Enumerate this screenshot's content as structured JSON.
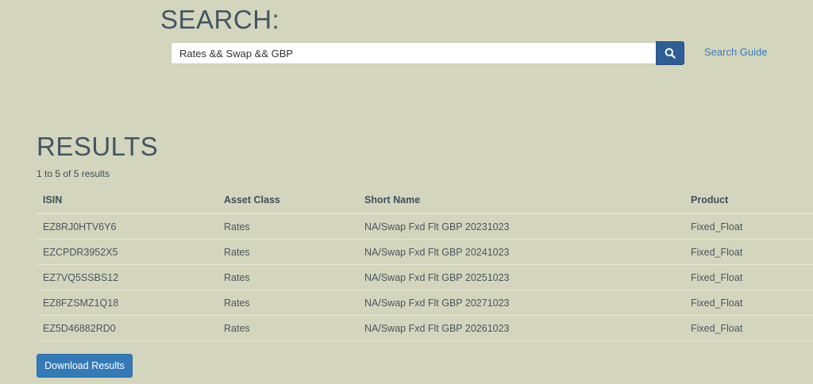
{
  "search": {
    "title": "SEARCH:",
    "query": "Rates && Swap && GBP",
    "guide_link": "Search Guide"
  },
  "results": {
    "title": "RESULTS",
    "count_text": "1 to 5 of 5 results",
    "columns": [
      "ISIN",
      "Asset Class",
      "Short Name",
      "Product"
    ],
    "rows": [
      {
        "isin": "EZ8RJ0HTV6Y6",
        "asset_class": "Rates",
        "short_name": "NA/Swap Fxd Flt GBP 20231023",
        "product": "Fixed_Float"
      },
      {
        "isin": "EZCPDR3952X5",
        "asset_class": "Rates",
        "short_name": "NA/Swap Fxd Flt GBP 20241023",
        "product": "Fixed_Float"
      },
      {
        "isin": "EZ7VQ5SSBS12",
        "asset_class": "Rates",
        "short_name": "NA/Swap Fxd Flt GBP 20251023",
        "product": "Fixed_Float"
      },
      {
        "isin": "EZ8FZSMZ1Q18",
        "asset_class": "Rates",
        "short_name": "NA/Swap Fxd Flt GBP 20271023",
        "product": "Fixed_Float"
      },
      {
        "isin": "EZ5D46882RD0",
        "asset_class": "Rates",
        "short_name": "NA/Swap Fxd Flt GBP 20261023",
        "product": "Fixed_Float"
      }
    ],
    "download_label": "Download Results"
  },
  "icons": {
    "search_button": "search-icon"
  },
  "colors": {
    "background": "#d3d6bd",
    "primary_button": "#337ab7",
    "search_button": "#2e5e95",
    "link": "#3b7bb8"
  }
}
